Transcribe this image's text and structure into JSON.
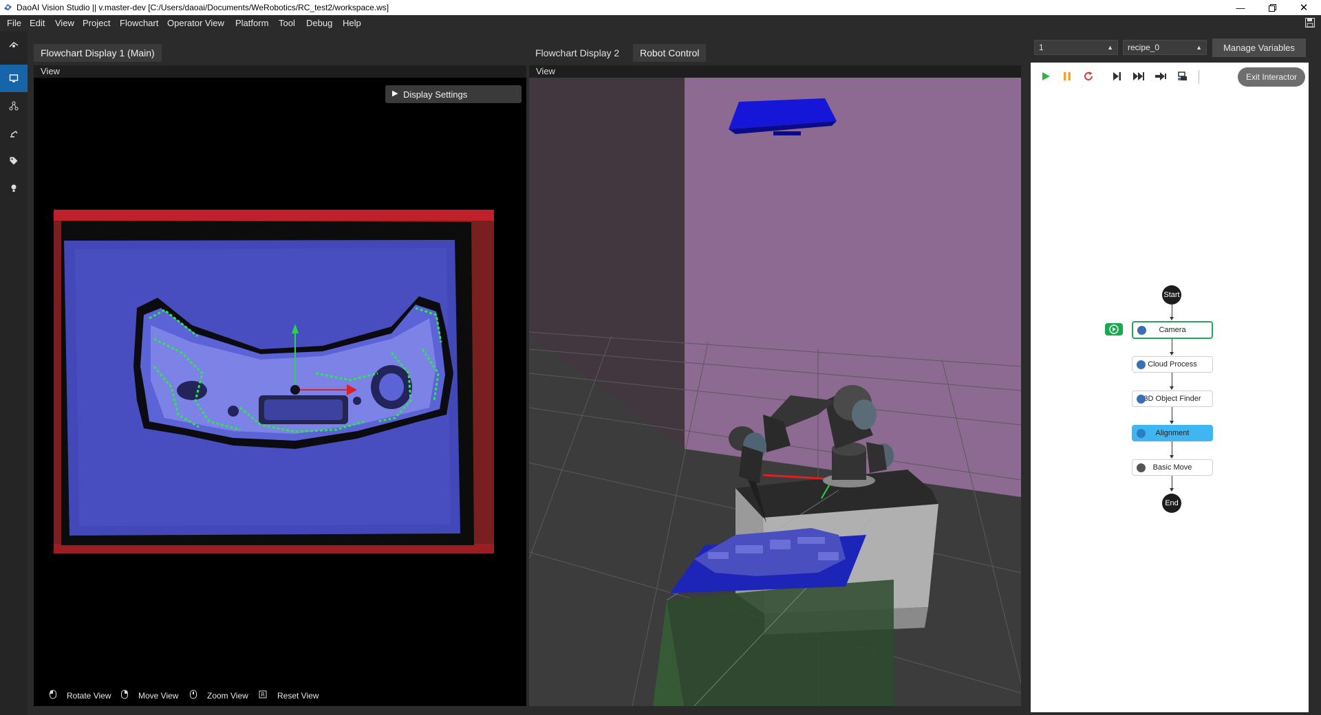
{
  "window": {
    "title": "DaoAI Vision Studio || v.master-dev   [C:/Users/daoai/Documents/WeRobotics/RC_test2/workspace.ws]"
  },
  "menu": [
    "File",
    "Edit",
    "View",
    "Project",
    "Flowchart",
    "Operator View",
    "Platform",
    "Tool",
    "Debug",
    "Help"
  ],
  "sidebar": {
    "items": [
      {
        "icon": "eye-target-icon"
      },
      {
        "icon": "monitor-icon",
        "active": true
      },
      {
        "icon": "graph-nodes-icon"
      },
      {
        "icon": "robot-arm-icon"
      },
      {
        "icon": "tag-icon"
      },
      {
        "icon": "lightbulb-icon"
      }
    ]
  },
  "panel1": {
    "tab": "Flowchart Display 1 (Main)",
    "view_label": "View",
    "display_settings": "Display Settings",
    "hints": [
      {
        "icon": "mouse-left-icon",
        "label": "Rotate View"
      },
      {
        "icon": "mouse-right-icon",
        "label": "Move View"
      },
      {
        "icon": "mouse-wheel-icon",
        "label": "Zoom View"
      },
      {
        "icon": "reset-view-icon",
        "label": "Reset View"
      }
    ]
  },
  "panel2": {
    "tabs": [
      "Flowchart Display 2",
      "Robot Control"
    ],
    "view_label": "View"
  },
  "right": {
    "combo1": "1",
    "combo2": "recipe_0",
    "manage_variables": "Manage Variables",
    "exit_interactor": "Exit Interactor",
    "toolbar": [
      "play-icon",
      "pause-icon",
      "restart-icon",
      "step-icon",
      "fast-forward-icon",
      "jump-icon",
      "breakpoint-icon"
    ],
    "flow": {
      "start": "Start",
      "end": "End",
      "nodes": [
        "Camera",
        "Cloud Process",
        "3D Object Finder",
        "Alignment",
        "Basic Move"
      ]
    }
  },
  "colors": {
    "accent": "#1565a8",
    "node_active_fill": "#3fb6f2",
    "node_running_border": "#1fa85a"
  }
}
